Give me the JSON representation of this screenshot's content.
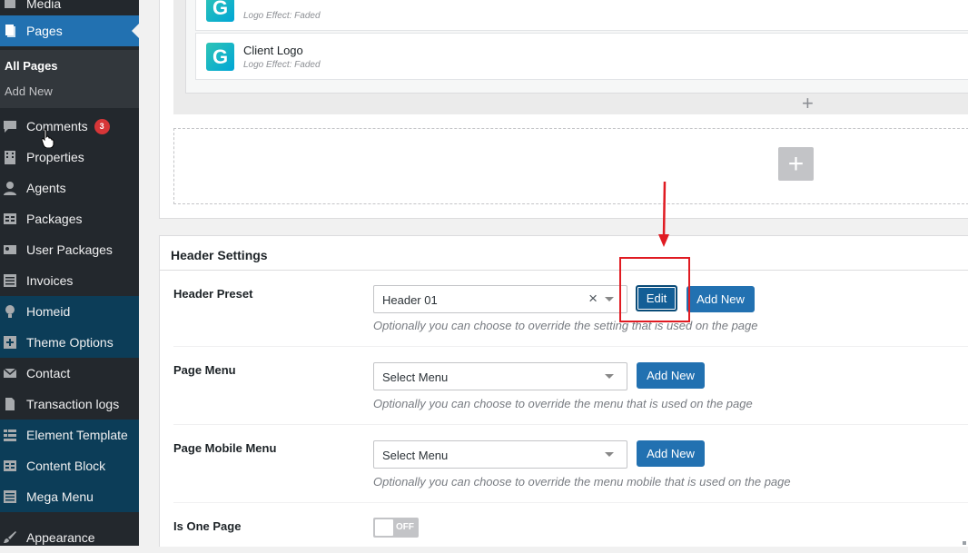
{
  "sidebar": {
    "top_partial": "Media",
    "pages": "Pages",
    "submenu": {
      "all_pages": "All Pages",
      "add_new": "Add New"
    },
    "items": [
      {
        "label": "Comments",
        "badge": "3"
      },
      {
        "label": "Properties"
      },
      {
        "label": "Agents"
      },
      {
        "label": "Packages"
      },
      {
        "label": "User Packages"
      },
      {
        "label": "Invoices"
      },
      {
        "label": "Homeid"
      },
      {
        "label": "Theme Options"
      },
      {
        "label": "Contact"
      },
      {
        "label": "Transaction logs"
      },
      {
        "label": "Element Template"
      },
      {
        "label": "Content Block"
      },
      {
        "label": "Mega Menu"
      },
      {
        "label": "Appearance"
      }
    ]
  },
  "builder": {
    "logos": [
      {
        "letter": "G",
        "name": "",
        "effect": "Logo Effect: Faded"
      },
      {
        "letter": "G",
        "name": "Client Logo",
        "effect": "Logo Effect: Faded"
      }
    ],
    "add_symbol": "+"
  },
  "header_settings": {
    "title": "Header Settings",
    "preset": {
      "label": "Header Preset",
      "value": "Header 01",
      "clear": "×",
      "edit_label": "Edit",
      "add_label": "Add New",
      "hint": "Optionally you can choose to override the setting that is used on the page"
    },
    "page_menu": {
      "label": "Page Menu",
      "value": "Select Menu",
      "add_label": "Add New",
      "hint": "Optionally you can choose to override the menu that is used on the page"
    },
    "mobile_menu": {
      "label": "Page Mobile Menu",
      "value": "Select Menu",
      "add_label": "Add New",
      "hint": "Optionally you can choose to override the menu mobile that is used on the page"
    },
    "one_page": {
      "label": "Is One Page",
      "state": "OFF"
    }
  },
  "colors": {
    "sidebar_bg": "#23282d",
    "accent": "#2271b1",
    "annotation": "#e01b22",
    "badge": "#d63638"
  }
}
